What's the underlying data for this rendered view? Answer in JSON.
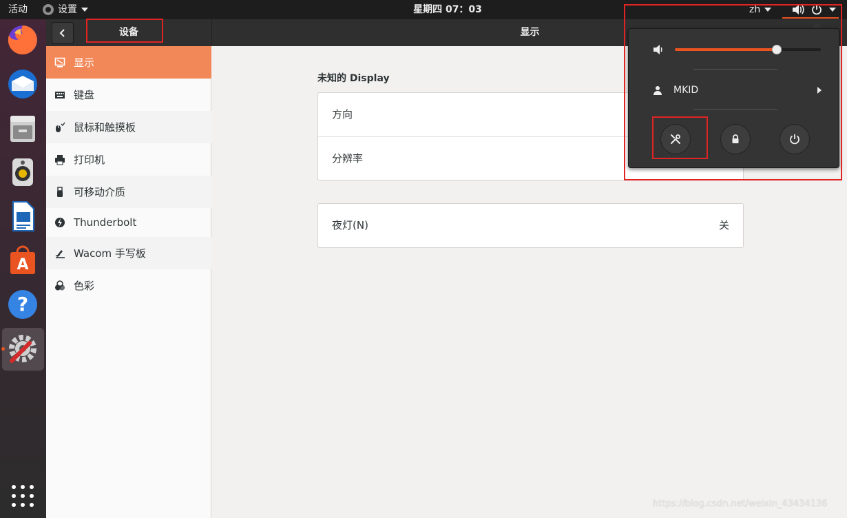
{
  "topbar": {
    "activities": "活动",
    "app_menu": "设置",
    "clock": "星期四 07：03",
    "lang": "zh"
  },
  "dock": {
    "apps": [
      "firefox-icon",
      "thunderbird-icon",
      "files-icon",
      "rhythmbox-icon",
      "writer-icon",
      "software-icon",
      "help-icon",
      "settings-icon",
      "show-apps-icon"
    ]
  },
  "header": {
    "back_icon": "chevron-left-icon",
    "left_title": "设备",
    "right_title": "显示"
  },
  "sidebar": {
    "items": [
      {
        "label": "显示",
        "icon": "display-icon",
        "active": true
      },
      {
        "label": "键盘",
        "icon": "keyboard-icon"
      },
      {
        "label": "鼠标和触摸板",
        "icon": "mouse-icon"
      },
      {
        "label": "打印机",
        "icon": "printer-icon"
      },
      {
        "label": "可移动介质",
        "icon": "usb-icon"
      },
      {
        "label": "Thunderbolt",
        "icon": "thunderbolt-icon"
      },
      {
        "label": "Wacom 手写板",
        "icon": "tablet-icon"
      },
      {
        "label": "色彩",
        "icon": "color-icon"
      }
    ]
  },
  "main": {
    "section_title": "未知的 Display",
    "rows": [
      {
        "label": "方向"
      },
      {
        "label": "分辨率"
      }
    ],
    "night_light": {
      "label": "夜灯(N)",
      "value": "关"
    }
  },
  "popover": {
    "volume": 0.7,
    "user": "MKID",
    "buttons": [
      "settings-tools-icon",
      "lock-icon",
      "power-icon"
    ]
  },
  "colors": {
    "accent": "#e95420",
    "sidebar_active": "#f28757",
    "highlight_box": "#e02424"
  },
  "watermark": "https://blog.csdn.net/weixin_43434136"
}
